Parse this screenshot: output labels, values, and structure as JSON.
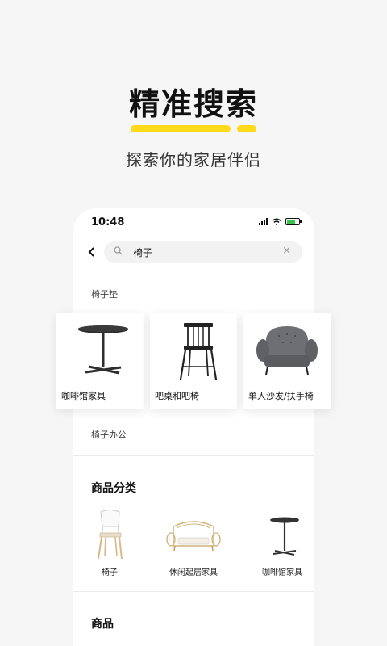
{
  "promo": {
    "headline": "精准搜索",
    "subheadline": "探索你的家居伴侣",
    "accent_color": "#ffda1a"
  },
  "status_bar": {
    "time": "10:48"
  },
  "search": {
    "query": "椅子"
  },
  "suggestions": [
    "椅子垫",
    "椅子办公"
  ],
  "product_cards": [
    {
      "label": "咖啡馆家具",
      "icon": "cafe-table-image"
    },
    {
      "label": "吧桌和吧椅",
      "icon": "bar-stool-image"
    },
    {
      "label": "单人沙发/扶手椅",
      "icon": "armchair-image"
    }
  ],
  "categories_section": {
    "title": "商品分类",
    "items": [
      {
        "label": "椅子",
        "icon": "chair-image"
      },
      {
        "label": "休闲起居家具",
        "icon": "rattan-sofa-image"
      },
      {
        "label": "咖啡馆家具",
        "icon": "cafe-table-image"
      }
    ]
  },
  "products_section": {
    "title": "商品"
  }
}
